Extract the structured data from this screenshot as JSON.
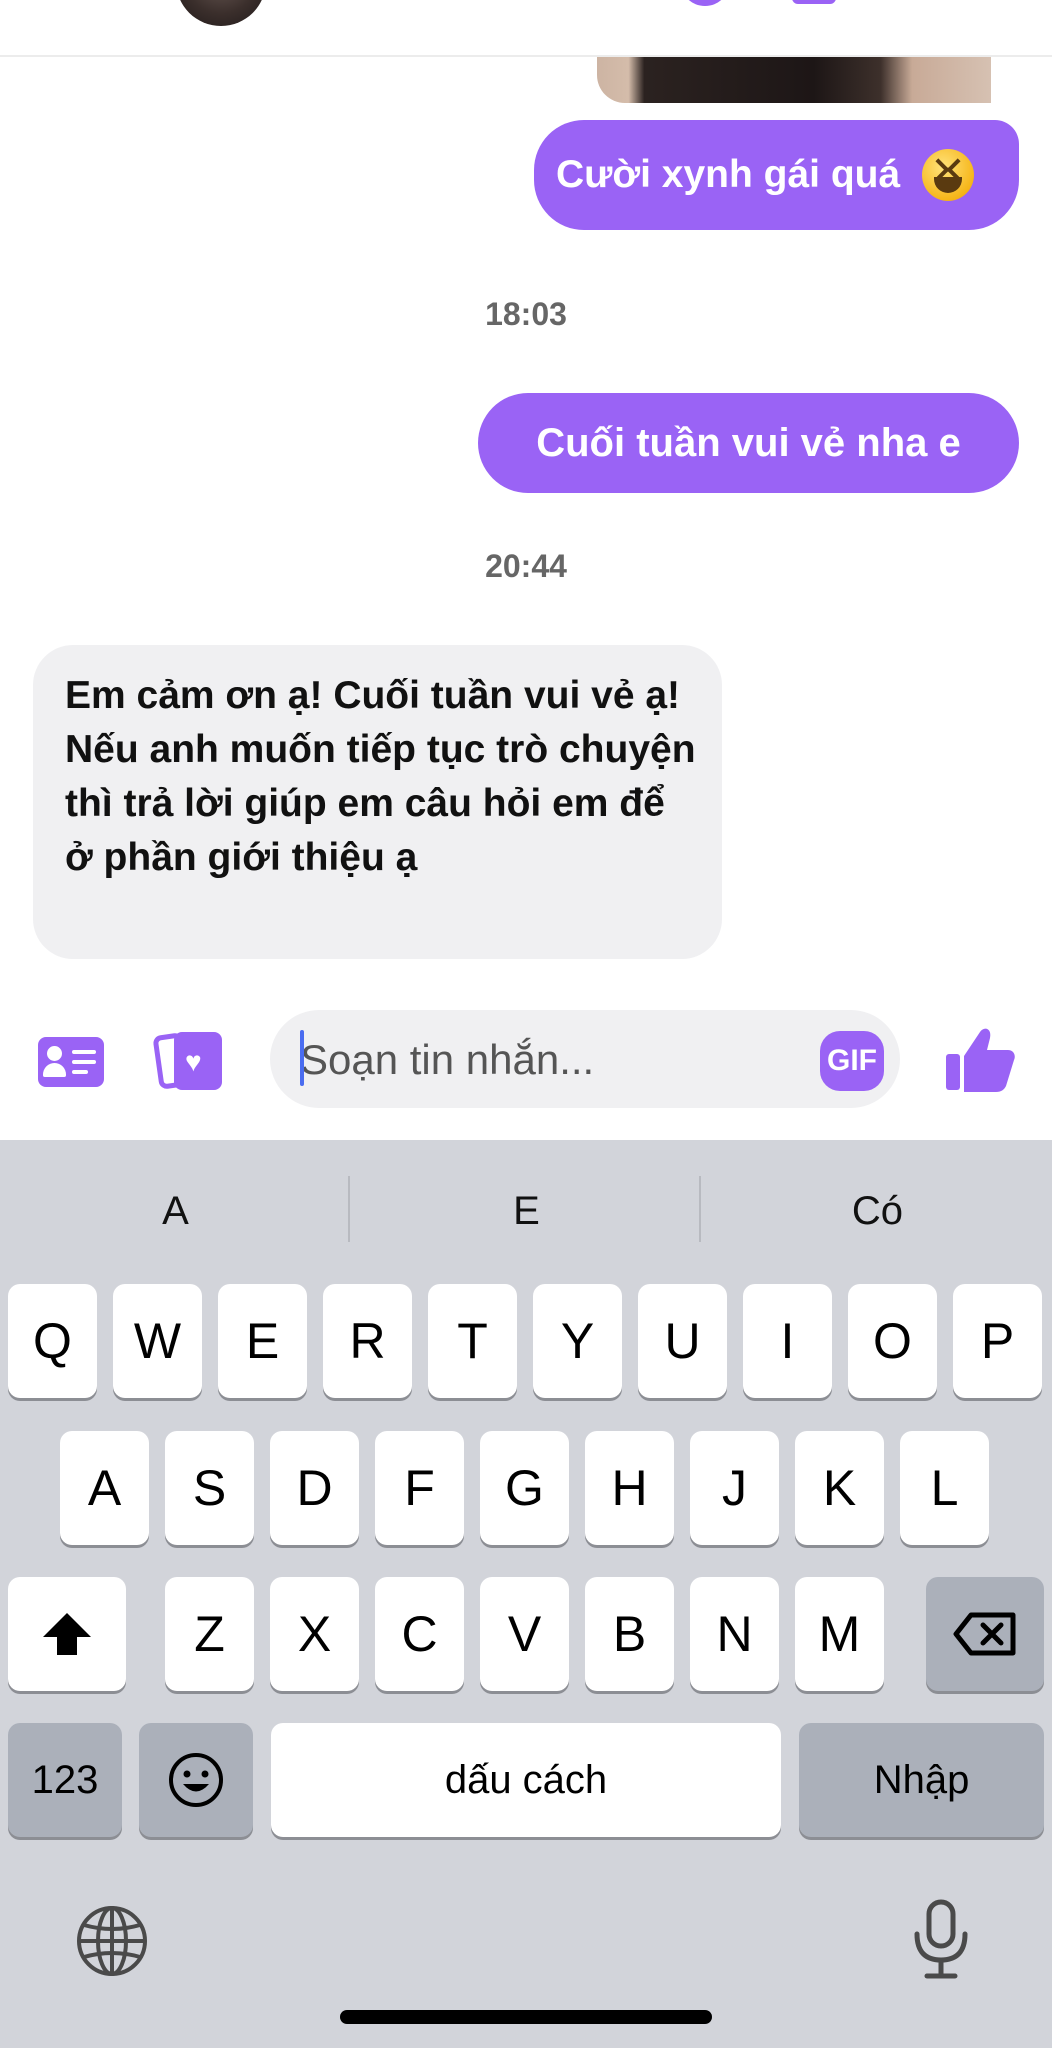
{
  "colors": {
    "accent": "#9a63f5",
    "incoming_bubble": "#f0f0f2",
    "keyboard_bg": "#d2d4da",
    "caret": "#4a6cf0"
  },
  "messages": {
    "m1": {
      "text": "Cười xynh gái quá",
      "emoji": "grinning-squinting-face"
    },
    "time1": "18:03",
    "m2": {
      "text": "Cuối tuần vui vẻ nha e"
    },
    "time2": "20:44",
    "m3": {
      "text": "Em cảm ơn ạ! Cuối tuần vui vẻ ạ! Nếu anh muốn tiếp tục trò chuyện thì trả lời giúp em câu hỏi em để ở phần giới thiệu ạ"
    }
  },
  "composer": {
    "placeholder": "Soạn tin nhắn...",
    "gif_label": "GIF",
    "icons": [
      "contact-card-icon",
      "cards-heart-icon",
      "thumbs-up-icon"
    ]
  },
  "keyboard": {
    "suggestions": [
      "A",
      "E",
      "Có"
    ],
    "row1": [
      "Q",
      "W",
      "E",
      "R",
      "T",
      "Y",
      "U",
      "I",
      "O",
      "P"
    ],
    "row2": [
      "A",
      "S",
      "D",
      "F",
      "G",
      "H",
      "J",
      "K",
      "L"
    ],
    "row3": [
      "Z",
      "X",
      "C",
      "V",
      "B",
      "N",
      "M"
    ],
    "numbers_label": "123",
    "space_label": "dấu cách",
    "return_label": "Nhập"
  }
}
